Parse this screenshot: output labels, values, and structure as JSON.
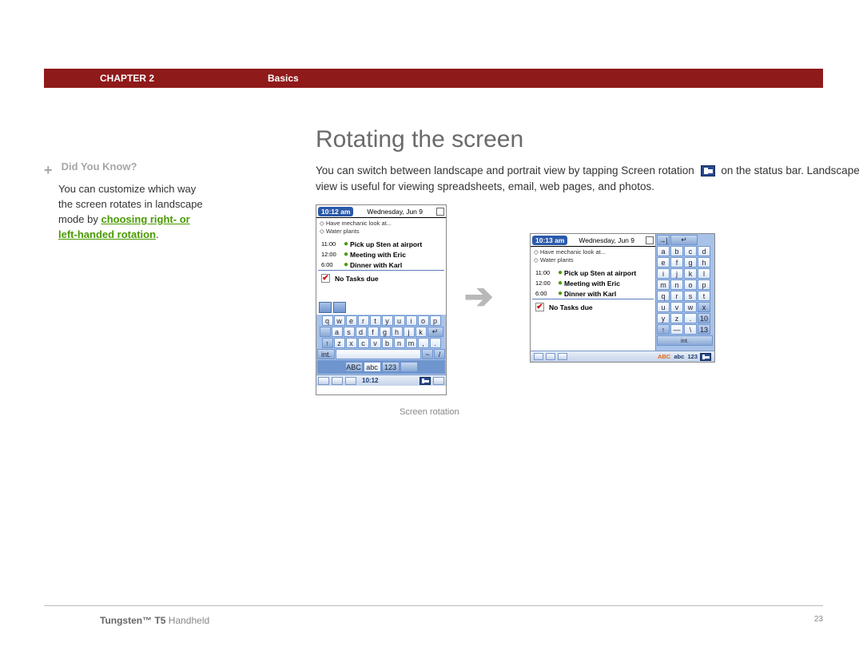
{
  "header": {
    "chapter": "CHAPTER 2",
    "section": "Basics"
  },
  "sidebar": {
    "plus": "+",
    "title": "Did You Know?",
    "text_before": "You can customize which way the screen rotates in landscape mode by ",
    "link": "choosing right- or left-handed rotation",
    "text_after": "."
  },
  "main": {
    "title": "Rotating the screen",
    "intro_a": "You can switch between landscape and portrait view by tapping Screen rotation ",
    "intro_b": " on the status bar. Landscape view is useful for viewing spreadsheets, email, web pages, and photos.",
    "caption": "Screen rotation"
  },
  "portrait": {
    "time": "10:12 am",
    "date": "Wednesday, Jun 9",
    "todo1": "◇ Have mechanic look at...",
    "todo2": "◇ Water plants",
    "agenda": [
      {
        "t": "11:00",
        "txt": "Pick up Sten at airport"
      },
      {
        "t": "12:00",
        "txt": "Meeting with Eric"
      },
      {
        "t": "6:00",
        "txt": "Dinner with Karl"
      }
    ],
    "notasks_check": "✔",
    "notasks": "No Tasks due",
    "kb_rows": [
      [
        "q",
        "w",
        "e",
        "r",
        "t",
        "y",
        "u",
        "i",
        "o",
        "p"
      ],
      [
        "a",
        "s",
        "d",
        "f",
        "g",
        "h",
        "j",
        "k",
        "l",
        "↵"
      ],
      [
        "↑",
        "z",
        "x",
        "c",
        "v",
        "b",
        "n",
        "m",
        ",",
        "."
      ]
    ],
    "kb_fn": {
      "int": "int.",
      "space": "",
      "tilde": "~",
      "slash": "/"
    },
    "status": {
      "abc": "ABC",
      "abc2": "abc",
      "num": "123",
      "clock": "10:12"
    }
  },
  "landscape": {
    "time": "10:13 am",
    "date": "Wednesday, Jun 9",
    "todo1": "◇ Have mechanic look at...",
    "todo2": "◇ Water plants",
    "agenda": [
      {
        "t": "11:00",
        "txt": "Pick up Sten at airport"
      },
      {
        "t": "12:00",
        "txt": "Meeting with Eric"
      },
      {
        "t": "6:00",
        "txt": "Dinner with Karl"
      }
    ],
    "notasks_check": "✔",
    "notasks": "No Tasks due",
    "kb_rows": [
      [
        "a",
        "b",
        "c",
        "d"
      ],
      [
        "e",
        "f",
        "g",
        "h"
      ],
      [
        "i",
        "j",
        "k",
        "l"
      ],
      [
        "m",
        "n",
        "o",
        "p"
      ],
      [
        "q",
        "r",
        "s",
        "t"
      ],
      [
        "u",
        "v",
        "w",
        "x"
      ],
      [
        "y",
        "z",
        ".",
        ","
      ],
      [
        "↑",
        "—",
        "\\",
        "/"
      ]
    ],
    "kb_side": {
      "arrow": "→|",
      "enter": "↵",
      "ten": "10",
      "thirteen": "13"
    },
    "kb_int": "int.",
    "status": {
      "abc": "ABC",
      "abc2": "abc",
      "num": "123"
    }
  },
  "footer": {
    "product_strong": "Tungsten™ T5",
    "product_rest": " Handheld",
    "page": "23"
  }
}
